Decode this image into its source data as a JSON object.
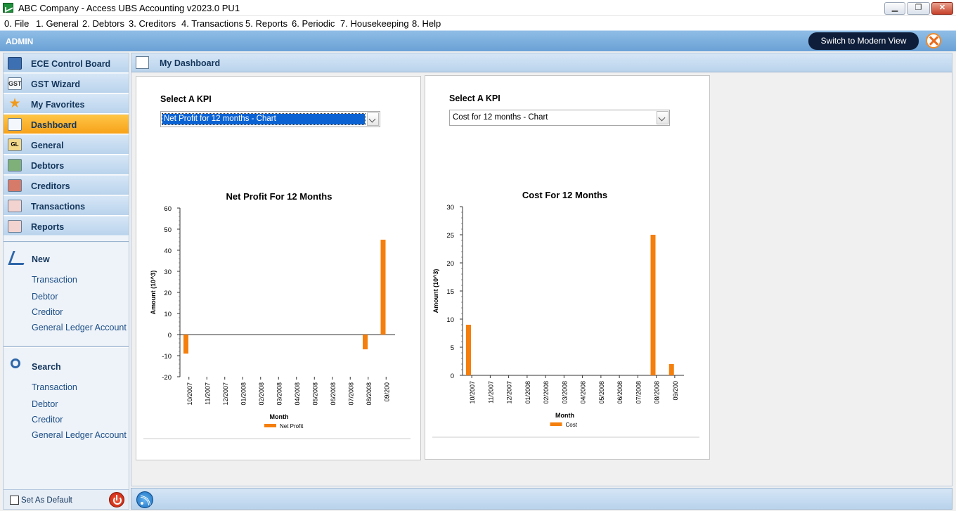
{
  "window": {
    "title": "ABC Company - Access UBS Accounting v2023.0 PU1"
  },
  "menu": [
    "0. File",
    "1. General",
    "2. Debtors",
    "3. Creditors",
    "4. Transactions",
    "5. Reports",
    "6. Periodic",
    "7. Housekeeping",
    "8. Help"
  ],
  "userbar": {
    "user": "ADMIN",
    "modern_view_label": "Switch to Modern View"
  },
  "sidebar": {
    "items": [
      {
        "label": "ECE Control Board",
        "icon": "monitor-icon",
        "active": false
      },
      {
        "label": "GST Wizard",
        "icon": "gst-icon",
        "active": false
      },
      {
        "label": "My Favorites",
        "icon": "star-icon",
        "active": false
      },
      {
        "label": "Dashboard",
        "icon": "chart-icon",
        "active": true
      },
      {
        "label": "General",
        "icon": "gl-icon",
        "active": false
      },
      {
        "label": "Debtors",
        "icon": "debtors-icon",
        "active": false
      },
      {
        "label": "Creditors",
        "icon": "creditors-icon",
        "active": false
      },
      {
        "label": "Transactions",
        "icon": "transactions-icon",
        "active": false
      },
      {
        "label": "Reports",
        "icon": "reports-icon",
        "active": false
      }
    ],
    "new_group": {
      "title": "New",
      "links": [
        "Transaction",
        "Debtor",
        "Creditor",
        "General Ledger Account"
      ]
    },
    "search_group": {
      "title": "Search",
      "links": [
        "Transaction",
        "Debtor",
        "Creditor",
        "General Ledger Account"
      ]
    },
    "footer": {
      "set_default_label": "Set As Default",
      "set_default_checked": false
    }
  },
  "content": {
    "title": "My Dashboard",
    "panels": [
      {
        "kpi_label": "Select A KPI",
        "kpi_value": "Net Profit for 12 months - Chart",
        "focused": true
      },
      {
        "kpi_label": "Select A KPI",
        "kpi_value": "Cost for 12 months - Chart",
        "focused": false
      }
    ]
  },
  "colors": {
    "bar": "#f57f0c",
    "active_nav": "#f7a21a",
    "header": "#b9d3ec"
  },
  "chart_data": [
    {
      "type": "bar",
      "title": "Net Profit For 12 Months",
      "xlabel": "Month",
      "ylabel": "Amount (10^3)",
      "categories": [
        "10/2007",
        "11/2007",
        "12/2007",
        "01/2008",
        "02/2008",
        "03/2008",
        "04/2008",
        "05/2008",
        "06/2008",
        "07/2008",
        "08/2008",
        "09/200"
      ],
      "series": [
        {
          "name": "Net Profit",
          "values": [
            -9,
            0,
            0,
            0,
            0,
            0,
            0,
            0,
            0,
            0,
            -7,
            45
          ]
        }
      ],
      "ylim": [
        -20,
        60
      ],
      "yticks": [
        60,
        50,
        40,
        30,
        20,
        10,
        0,
        -10,
        -20
      ],
      "grid": false,
      "legend": "bottom-center"
    },
    {
      "type": "bar",
      "title": "Cost For 12 Months",
      "xlabel": "Month",
      "ylabel": "Amount (10^3)",
      "categories": [
        "10/2007",
        "11/2007",
        "12/2007",
        "01/2008",
        "02/2008",
        "03/2008",
        "04/2008",
        "05/2008",
        "06/2008",
        "07/2008",
        "08/2008",
        "09/200"
      ],
      "series": [
        {
          "name": "Cost",
          "values": [
            9,
            0,
            0,
            0,
            0,
            0,
            0,
            0,
            0,
            0,
            25,
            2
          ]
        }
      ],
      "ylim": [
        0,
        30
      ],
      "yticks": [
        30,
        25,
        20,
        15,
        10,
        5,
        0
      ],
      "grid": false,
      "legend": "bottom-center"
    }
  ]
}
